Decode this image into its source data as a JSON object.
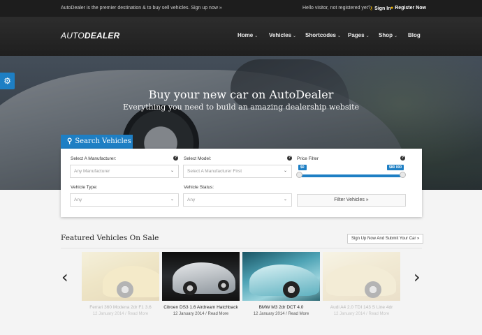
{
  "topbar": {
    "tagline": "AutoDealer is the premier destination & to buy sell vehicles. Sign up now »",
    "visitor_text": "Hello visitor, not registered yet?",
    "sign_in": "Sign In",
    "register": "Register Now"
  },
  "header": {
    "logo_part1": "AUTO",
    "logo_part2": "DEALER",
    "nav": [
      {
        "label": "Home",
        "dropdown": true
      },
      {
        "label": "Vehicles",
        "dropdown": true
      },
      {
        "label": "Shortcodes",
        "dropdown": true
      },
      {
        "label": "Pages",
        "dropdown": true
      },
      {
        "label": "Shop",
        "dropdown": true
      },
      {
        "label": "Blog",
        "dropdown": false
      }
    ]
  },
  "hero": {
    "title": "Buy your new car on AutoDealer",
    "subtitle": "Everything you need to build an amazing dealership website"
  },
  "search": {
    "tab_label": "Search Vehicles",
    "manufacturer_label": "Select A Manufacturer:",
    "manufacturer_value": "Any Manufacturer",
    "model_label": "Select Model:",
    "model_value": "Select A Manufacturer First",
    "price_label": "Price Filter",
    "price_min": "$0",
    "price_max": "$80 000",
    "type_label": "Vehicle Type:",
    "type_value": "Any",
    "status_label": "Vehicle Status:",
    "status_value": "Any",
    "filter_button": "Filter Vehicles »",
    "help_glyph": "?"
  },
  "featured": {
    "title": "Featured Vehicles On Sale",
    "submit_button": "Sign Up Now And Submit Your Car »",
    "prev_arrow": "‹",
    "next_arrow": "›",
    "items": [
      {
        "title": "Ferrari 360 Modena 2dr F1 3.6",
        "date": "12 January 2014 / Read More",
        "faded": true
      },
      {
        "title": "Citroen DS3 1.6 Airdream Hatchback",
        "date": "12 January 2014 / Read More",
        "faded": false
      },
      {
        "title": "BMW M3 2dr DCT 4.0",
        "date": "12 January 2014 / Read More",
        "faded": false
      },
      {
        "title": "Audi A4 2.0 TDI 143 S Line 4dr",
        "date": "12 January 2014 / Read More",
        "faded": true
      }
    ]
  },
  "colors": {
    "accent": "#1e7fc4",
    "topbar": "#1d1d1d",
    "header": "#262626",
    "signin_icon": "#f0b600"
  },
  "icons": {
    "side_tab": "gears-icon",
    "search": "search-icon",
    "signin": "key-icon",
    "register": "user-icon"
  }
}
